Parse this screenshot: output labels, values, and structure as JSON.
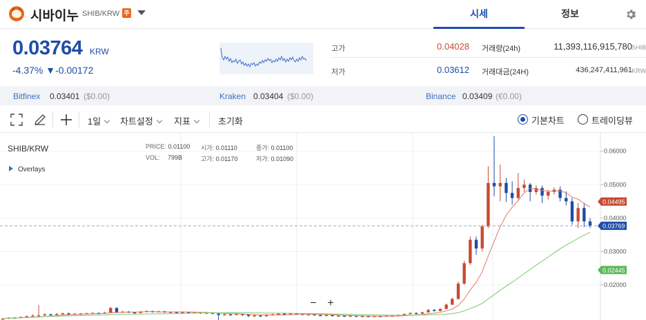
{
  "header": {
    "coin_name": "시바이누",
    "pair": "SHIB/KRW",
    "warning_badge": "주",
    "tabs": [
      "시세",
      "정보"
    ]
  },
  "price": {
    "current": "0.03764",
    "unit": "KRW",
    "change_pct": "-4.37%",
    "change_arrow": "▼",
    "change_abs": "-0.00172"
  },
  "stats": {
    "high_label": "고가",
    "high_value": "0.04028",
    "low_label": "저가",
    "low_value": "0.03612",
    "volume_label": "거래량(24h)",
    "volume_value": "11,393,116,915,780",
    "volume_unit": "SHIB",
    "amount_label": "거래대금(24H)",
    "amount_value": "436,247,411,961",
    "amount_unit": "KRW"
  },
  "exchanges": [
    {
      "name": "Bitfinex",
      "price": "0.03401",
      "sub": "($0.00)"
    },
    {
      "name": "Kraken",
      "price": "0.03404",
      "sub": "($0.00)"
    },
    {
      "name": "Binance",
      "price": "0.03409",
      "sub": "(€0.00)"
    }
  ],
  "toolbar": {
    "interval": "1일",
    "chart_settings": "차트설정",
    "indicators": "지표",
    "reset": "초기화",
    "basic_chart": "기본차트",
    "tradingview": "트레이딩뷰"
  },
  "chart_legend": {
    "symbol": "SHIB/KRW",
    "overlays": "Overlays",
    "price_label": "PRICE:",
    "price_value": "0.01100",
    "open_label": "시가:",
    "open_value": "0.01110",
    "close_label": "종가:",
    "close_value": "0.01100",
    "vol_label": "VOL:",
    "vol_value": "799B",
    "high_label": "고가:",
    "high_value": "0.01170",
    "low_label": "저가:",
    "low_value": "0.01090",
    "zoom_out": "−",
    "zoom_in": "+"
  },
  "colors": {
    "up": "#c84a31",
    "down": "#1e4da8",
    "ma_short": "#e07862",
    "ma_long": "#7ac86c"
  },
  "chart_data": {
    "type": "candlestick",
    "y_tick_labels": [
      "0.06000",
      "0.05000",
      "0.04000",
      "0.03000",
      "0.02000"
    ],
    "ylim": [
      0.0095,
      0.0655
    ],
    "price_tags": [
      {
        "label": "0.04495",
        "value": 0.04495,
        "color": "#c84a31"
      },
      {
        "label": "0.03769",
        "value": 0.03769,
        "color": "#1e4da8"
      },
      {
        "label": "0.02445",
        "value": 0.02445,
        "color": "#5cb85c"
      }
    ],
    "candles": [
      [
        0.0098,
        0.0099,
        0.0101,
        0.0097
      ],
      [
        0.0099,
        0.0102,
        0.0103,
        0.0098
      ],
      [
        0.0102,
        0.0101,
        0.0104,
        0.01
      ],
      [
        0.0101,
        0.0104,
        0.0106,
        0.01
      ],
      [
        0.0104,
        0.0106,
        0.0109,
        0.0103
      ],
      [
        0.0106,
        0.0108,
        0.0112,
        0.0105
      ],
      [
        0.0108,
        0.0109,
        0.014,
        0.0106
      ],
      [
        0.0109,
        0.0112,
        0.0115,
        0.0107
      ],
      [
        0.0112,
        0.011,
        0.0114,
        0.0108
      ],
      [
        0.011,
        0.0113,
        0.0116,
        0.0109
      ],
      [
        0.0113,
        0.0115,
        0.0117,
        0.0111
      ],
      [
        0.0115,
        0.0112,
        0.0117,
        0.011
      ],
      [
        0.0112,
        0.0114,
        0.0116,
        0.011
      ],
      [
        0.0114,
        0.0113,
        0.0116,
        0.0111
      ],
      [
        0.0113,
        0.0115,
        0.0117,
        0.0112
      ],
      [
        0.0115,
        0.0116,
        0.0118,
        0.0113
      ],
      [
        0.0116,
        0.0114,
        0.0118,
        0.0112
      ],
      [
        0.0114,
        0.0117,
        0.012,
        0.0113
      ],
      [
        0.0117,
        0.0131,
        0.0134,
        0.0116
      ],
      [
        0.0131,
        0.0118,
        0.0133,
        0.0116
      ],
      [
        0.0118,
        0.012,
        0.0123,
        0.0117
      ],
      [
        0.012,
        0.0118,
        0.0122,
        0.0116
      ],
      [
        0.0118,
        0.0116,
        0.012,
        0.0114
      ],
      [
        0.0116,
        0.012,
        0.0122,
        0.0115
      ],
      [
        0.012,
        0.0122,
        0.0124,
        0.0118
      ],
      [
        0.0122,
        0.0119,
        0.0123,
        0.0117
      ],
      [
        0.0119,
        0.0121,
        0.0123,
        0.0118
      ],
      [
        0.0121,
        0.0118,
        0.0122,
        0.0116
      ],
      [
        0.0118,
        0.0119,
        0.0121,
        0.0116
      ],
      [
        0.0119,
        0.0117,
        0.012,
        0.0115
      ],
      [
        0.0117,
        0.0119,
        0.0121,
        0.0115
      ],
      [
        0.0119,
        0.0116,
        0.012,
        0.0114
      ],
      [
        0.0116,
        0.0118,
        0.012,
        0.0115
      ],
      [
        0.0118,
        0.0115,
        0.0119,
        0.0113
      ],
      [
        0.0115,
        0.0117,
        0.0119,
        0.0113
      ],
      [
        0.0117,
        0.0114,
        0.0118,
        0.0112
      ],
      [
        0.0114,
        0.011,
        0.0116,
        0.0095
      ],
      [
        0.011,
        0.0112,
        0.0114,
        0.0108
      ],
      [
        0.0112,
        0.011,
        0.0113,
        0.0108
      ],
      [
        0.011,
        0.0113,
        0.0115,
        0.0109
      ],
      [
        0.0113,
        0.0111,
        0.0114,
        0.0107
      ],
      [
        0.0111,
        0.0107,
        0.0112,
        0.0103
      ],
      [
        0.0107,
        0.0109,
        0.0111,
        0.0104
      ],
      [
        0.0109,
        0.0106,
        0.011,
        0.0103
      ],
      [
        0.0106,
        0.011,
        0.0113,
        0.0105
      ],
      [
        0.011,
        0.0112,
        0.0114,
        0.0108
      ],
      [
        0.0112,
        0.0114,
        0.0116,
        0.011
      ],
      [
        0.0114,
        0.0112,
        0.0117,
        0.011
      ],
      [
        0.0112,
        0.0115,
        0.0117,
        0.0111
      ],
      [
        0.0115,
        0.0113,
        0.0116,
        0.0111
      ],
      [
        0.0113,
        0.0111,
        0.0115,
        0.0109
      ],
      [
        0.0111,
        0.0112,
        0.0114,
        0.0109
      ],
      [
        0.0112,
        0.011,
        0.0113,
        0.0108
      ],
      [
        0.011,
        0.0108,
        0.0112,
        0.0106
      ],
      [
        0.0108,
        0.011,
        0.0111,
        0.0106
      ],
      [
        0.011,
        0.0107,
        0.0111,
        0.0105
      ],
      [
        0.0107,
        0.0108,
        0.011,
        0.0105
      ],
      [
        0.0108,
        0.0106,
        0.0109,
        0.0104
      ],
      [
        0.0106,
        0.0108,
        0.011,
        0.0104
      ],
      [
        0.0108,
        0.0105,
        0.0109,
        0.0103
      ],
      [
        0.0105,
        0.0107,
        0.0109,
        0.0103
      ],
      [
        0.0107,
        0.0105,
        0.0108,
        0.0103
      ],
      [
        0.0105,
        0.0107,
        0.0109,
        0.0104
      ],
      [
        0.0107,
        0.0106,
        0.0108,
        0.0104
      ],
      [
        0.0106,
        0.0108,
        0.011,
        0.0104
      ],
      [
        0.0108,
        0.0107,
        0.0109,
        0.0105
      ],
      [
        0.0107,
        0.011,
        0.0112,
        0.0106
      ],
      [
        0.011,
        0.0113,
        0.0115,
        0.0109
      ],
      [
        0.0113,
        0.0116,
        0.0118,
        0.0112
      ],
      [
        0.0116,
        0.0114,
        0.0118,
        0.0112
      ],
      [
        0.0114,
        0.0118,
        0.012,
        0.0113
      ],
      [
        0.0118,
        0.0125,
        0.0128,
        0.0117
      ],
      [
        0.0125,
        0.0122,
        0.0128,
        0.012
      ],
      [
        0.0122,
        0.0128,
        0.0131,
        0.0121
      ],
      [
        0.0128,
        0.0141,
        0.0144,
        0.0127
      ],
      [
        0.0141,
        0.0158,
        0.0162,
        0.0139
      ],
      [
        0.0158,
        0.0204,
        0.021,
        0.0156
      ],
      [
        0.0204,
        0.0265,
        0.0272,
        0.02
      ],
      [
        0.0265,
        0.0335,
        0.0345,
        0.026
      ],
      [
        0.0335,
        0.0309,
        0.0345,
        0.029
      ],
      [
        0.0309,
        0.0375,
        0.038,
        0.03
      ],
      [
        0.0375,
        0.0505,
        0.0555,
        0.037
      ],
      [
        0.0505,
        0.0495,
        0.0645,
        0.0465
      ],
      [
        0.0495,
        0.0505,
        0.056,
        0.045
      ],
      [
        0.0505,
        0.0475,
        0.052,
        0.0448
      ],
      [
        0.0475,
        0.046,
        0.051,
        0.044
      ],
      [
        0.046,
        0.049,
        0.0535,
        0.0455
      ],
      [
        0.049,
        0.05,
        0.0515,
        0.0478
      ],
      [
        0.05,
        0.0478,
        0.0505,
        0.045
      ],
      [
        0.0478,
        0.049,
        0.0498,
        0.047
      ],
      [
        0.049,
        0.0467,
        0.0497,
        0.0445
      ],
      [
        0.0467,
        0.0478,
        0.0485,
        0.0455
      ],
      [
        0.0478,
        0.0485,
        0.0492,
        0.047
      ],
      [
        0.0485,
        0.046,
        0.0495,
        0.045
      ],
      [
        0.046,
        0.045,
        0.048,
        0.0438
      ],
      [
        0.045,
        0.039,
        0.046,
        0.038
      ],
      [
        0.039,
        0.043,
        0.0445,
        0.037
      ],
      [
        0.043,
        0.039,
        0.0445,
        0.0373
      ],
      [
        0.039,
        0.0376,
        0.04,
        0.037
      ]
    ]
  }
}
